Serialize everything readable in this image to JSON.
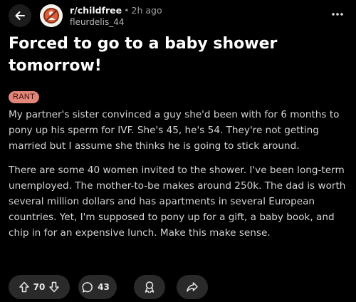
{
  "header": {
    "subreddit": "r/childfree",
    "separator": "•",
    "time_ago": "2h ago",
    "username": "fleurdelis_44",
    "back_icon": "arrow-left-icon",
    "avatar_icon": "subreddit-avatar-icon",
    "more_icon": "more-vertical-icon"
  },
  "post": {
    "title": "Forced to go to a baby shower tomorrow!",
    "flair": "RANT",
    "flair_color": "#e2857a",
    "paragraphs": [
      "My partner's sister convinced a guy she'd been with for 6 months to pony up his sperm for IVF. She's 45, he's 54. They're not getting married but I assume she thinks he is going to stick around.",
      "There are some 40 women invited to the shower. I've been long-term unemployed. The mother-to-be makes around 250k. The dad is worth several million dollars and has apartments in several European countries. Yet, I'm supposed to pony up for a gift, a baby book, and chip in for an expensive lunch. Make this make sense."
    ]
  },
  "actions": {
    "upvote_icon": "upvote-icon",
    "vote_count": "70",
    "downvote_icon": "downvote-icon",
    "comment_icon": "comment-icon",
    "comment_count": "43",
    "award_icon": "award-icon",
    "share_icon": "share-icon"
  },
  "colors": {
    "background": "#000000",
    "pill_background": "#2a2a2a",
    "text_primary": "#ffffff",
    "text_body": "#d4d4d4"
  }
}
